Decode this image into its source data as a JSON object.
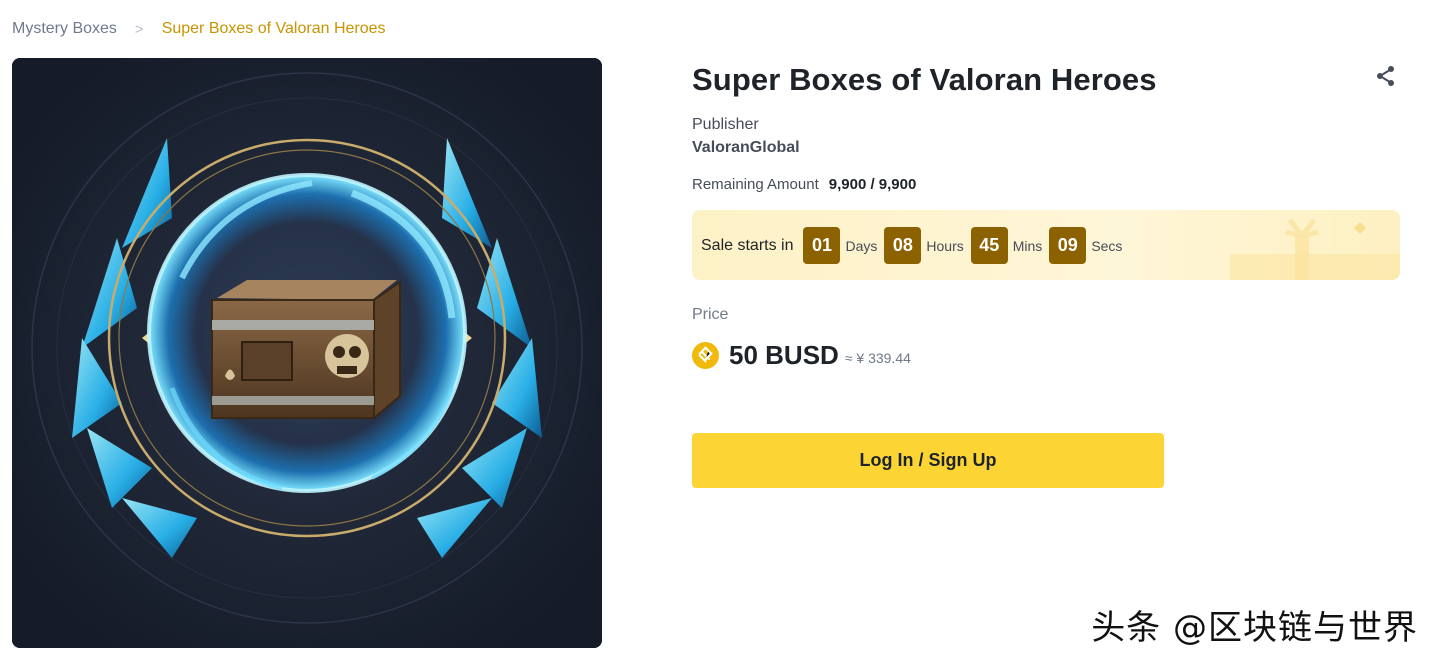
{
  "breadcrumb": {
    "root": "Mystery Boxes",
    "separator": ">",
    "current": "Super Boxes of Valoran Heroes"
  },
  "product": {
    "title": "Super Boxes of Valoran Heroes",
    "share_icon": "share-icon",
    "publisher_label": "Publisher",
    "publisher_value": "ValoranGlobal",
    "remaining_label": "Remaining Amount",
    "remaining_value": "9,900 / 9,900"
  },
  "sale": {
    "label": "Sale starts in",
    "countdown": [
      {
        "value": "01",
        "unit": "Days"
      },
      {
        "value": "08",
        "unit": "Hours"
      },
      {
        "value": "45",
        "unit": "Mins"
      },
      {
        "value": "09",
        "unit": "Secs"
      }
    ]
  },
  "price": {
    "label": "Price",
    "currency_icon": "busd-coin-icon",
    "value": "50 BUSD",
    "approx": "≈ ¥ 339.44"
  },
  "cta": {
    "label": "Log In / Sign Up"
  },
  "watermark": "头条 @区块链与世界",
  "colors": {
    "brand_yellow": "#fcd535",
    "accent_gold": "#c99400",
    "countdown_bg": "#8c6100",
    "hero_bg": "#1a2130",
    "glow_blue": "#3fd0ff"
  }
}
